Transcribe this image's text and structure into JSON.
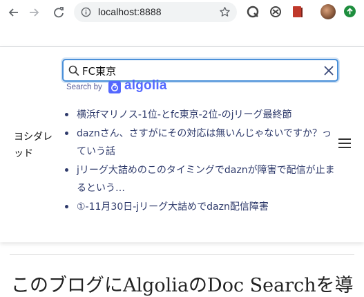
{
  "browser": {
    "url": "localhost:8888",
    "accent_update": "#1e8e3e"
  },
  "search": {
    "query": "FC東京",
    "search_by_label": "Search by",
    "provider_name": "algolia",
    "provider_color": "#5468ff"
  },
  "site": {
    "title": "ヨシダレッド"
  },
  "results": [
    {
      "text": "横浜fマリノス-1位-とfc東京-2位-のjリーグ最終節"
    },
    {
      "text": "daznさん、さすがにその対応は無いんじゃないですか？っていう話"
    },
    {
      "text": "jリーグ大詰めのこのタイミングでdaznが障害で配信が止まるという…"
    },
    {
      "text": "①-11月30日-jリーグ大詰めでdazn配信障害"
    }
  ],
  "article": {
    "title": "このブログにAlgoliaのDoc Searchを導"
  },
  "icons": [
    "back-arrow-icon",
    "forward-arrow-icon",
    "reload-icon",
    "info-icon",
    "star-icon",
    "extension-icon",
    "magnifier-icon",
    "clear-icon",
    "hamburger-menu-icon"
  ]
}
